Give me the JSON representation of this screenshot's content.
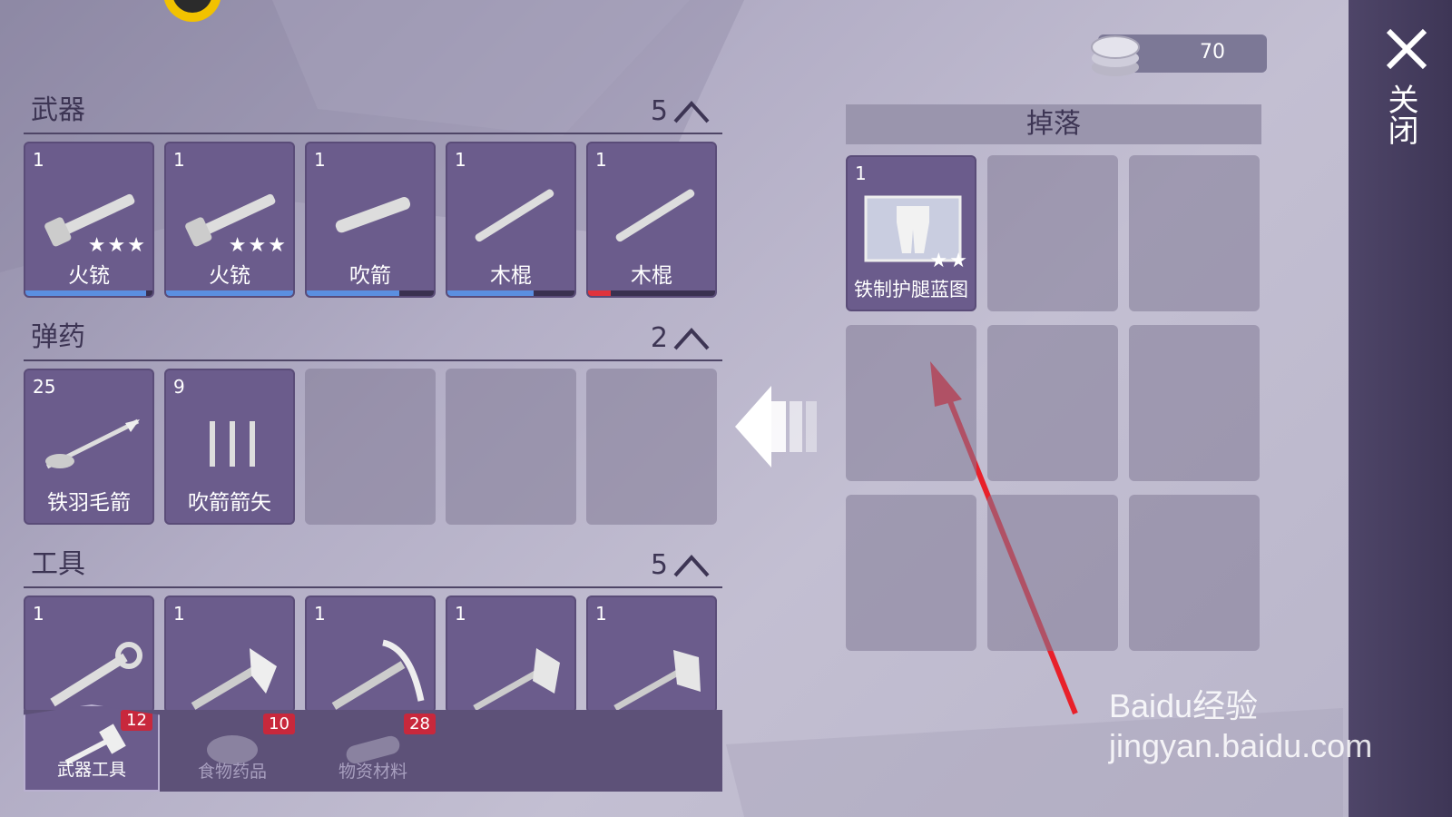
{
  "sections": [
    {
      "title": "武器",
      "count": "5"
    },
    {
      "title": "弹药",
      "count": "2"
    },
    {
      "title": "工具",
      "count": "5"
    }
  ],
  "weapons": [
    {
      "count": "1",
      "name": "火铳",
      "icon": "musket-icon",
      "stars": 3,
      "durability": 0.95,
      "bar_color": "#5b8fe0"
    },
    {
      "count": "1",
      "name": "火铳",
      "icon": "musket-icon",
      "stars": 3,
      "durability": 1.0,
      "bar_color": "#5b8fe0"
    },
    {
      "count": "1",
      "name": "吹箭",
      "icon": "blowgun-icon",
      "stars": 0,
      "durability": 0.73,
      "bar_color": "#5b8fe0"
    },
    {
      "count": "1",
      "name": "木棍",
      "icon": "wooden-stick-icon",
      "stars": 0,
      "durability": 0.68,
      "bar_color": "#5b8fe0"
    },
    {
      "count": "1",
      "name": "木棍",
      "icon": "wooden-stick-icon",
      "stars": 0,
      "durability": 0.18,
      "bar_color": "#e0333c"
    }
  ],
  "ammo": [
    {
      "count": "25",
      "name": "铁羽毛箭",
      "icon": "feather-arrow-icon"
    },
    {
      "count": "9",
      "name": "吹箭箭矢",
      "icon": "blowgun-darts-icon"
    }
  ],
  "tools": [
    {
      "count": "1",
      "icon": "wrench-icon"
    },
    {
      "count": "1",
      "icon": "axe-icon"
    },
    {
      "count": "1",
      "icon": "pickaxe-icon"
    },
    {
      "count": "1",
      "icon": "stone-axe-icon"
    },
    {
      "count": "1",
      "icon": "stone-hammer-icon"
    }
  ],
  "tabs": [
    {
      "label": "武器工具",
      "badge": "12",
      "icon": "hammer-icon",
      "active": true
    },
    {
      "label": "食物药品",
      "badge": "10",
      "icon": "meat-icon",
      "active": false
    },
    {
      "label": "物资材料",
      "badge": "28",
      "icon": "log-icon",
      "active": false
    }
  ],
  "currency": {
    "value": "70",
    "icon": "coin-stack-icon"
  },
  "drop": {
    "title": "掉落",
    "items": [
      {
        "count": "1",
        "name": "铁制护腿蓝图",
        "icon": "leg-armor-blueprint-icon",
        "stars": 2
      }
    ]
  },
  "close": {
    "label": "关闭"
  },
  "watermark": "Baidu经验 jingyan.baidu.com",
  "colors": {
    "slot": "#6b5c8c",
    "accent_red": "#e0333c",
    "accent_blue": "#5b8fe0"
  }
}
